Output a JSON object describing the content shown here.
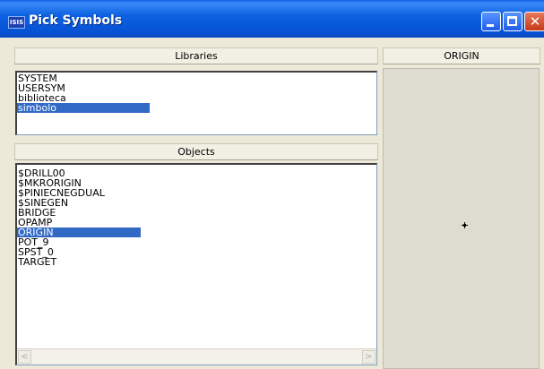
{
  "window": {
    "title": "Pick Symbols",
    "icon_text": "ISIS",
    "titlebar_color": "#0a5ee8"
  },
  "libraries": {
    "header": "Libraries",
    "items": [
      {
        "label": "SYSTEM",
        "selected": false
      },
      {
        "label": "USERSYM",
        "selected": false
      },
      {
        "label": "biblioteca",
        "selected": false
      },
      {
        "label": "simbolo",
        "selected": true
      }
    ]
  },
  "objects": {
    "header": "Objects",
    "items": [
      {
        "label": "$DRILL00",
        "selected": false
      },
      {
        "label": "$MKRORIGIN",
        "selected": false
      },
      {
        "label": "$PINIECNEGDUAL",
        "selected": false
      },
      {
        "label": "$SINEGEN",
        "selected": false
      },
      {
        "label": "BRIDGE",
        "selected": false
      },
      {
        "label": "OPAMP",
        "selected": false
      },
      {
        "label": "ORIGIN",
        "selected": true
      },
      {
        "label": "POT_9",
        "selected": false
      },
      {
        "label": "SPST_0",
        "selected": false
      },
      {
        "label": "TARGET",
        "selected": false
      }
    ]
  },
  "preview": {
    "header": "ORIGIN",
    "symbol": "crosshair-icon"
  },
  "colors": {
    "selection": "#316ac5",
    "dialog_bg": "#ece9d8"
  }
}
